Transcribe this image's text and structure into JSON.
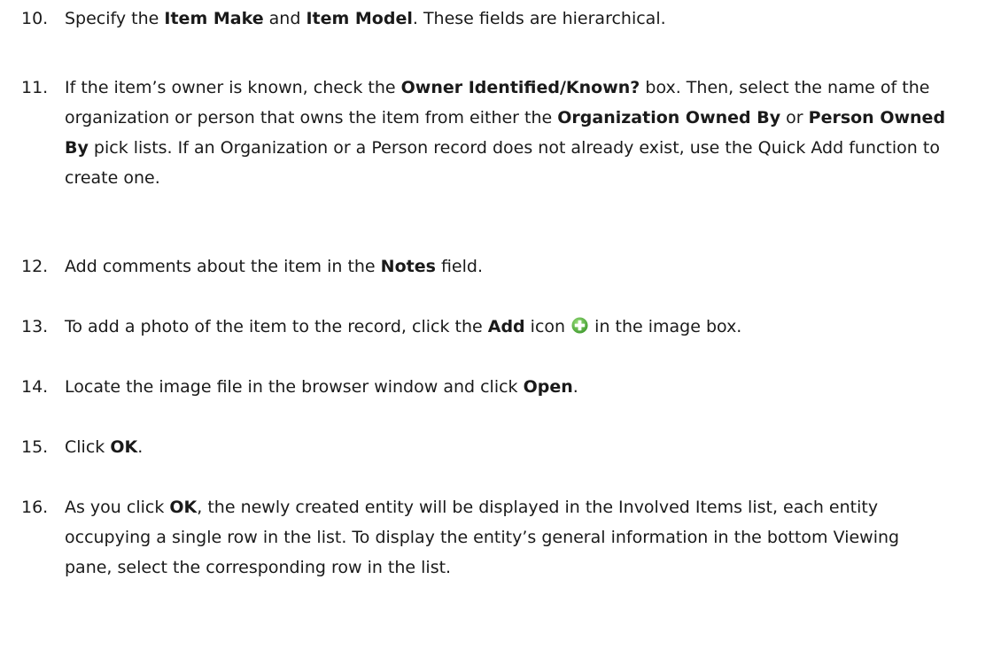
{
  "steps": [
    {
      "number": "10.",
      "t1": "Specify the ",
      "b1": "Item Make",
      "t2": " and ",
      "b2": "Item Model",
      "t3": ". These fields are hierarchical."
    },
    {
      "number": "11.",
      "t1": "If the item’s owner is known, check the ",
      "b1": "Owner Identified/Known?",
      "t2": " box. Then, select the name of the organization or person that owns the item from either the ",
      "b2": "Organization Owned By",
      "t3": " or ",
      "b3": "Person Owned By",
      "t4": " pick lists. If an Organization or a Person record does not already exist, use the Quick Add function to create one."
    },
    {
      "number": "12.",
      "t1": "Add comments about the item in the ",
      "b1": "Notes",
      "t2": " field."
    },
    {
      "number": "13.",
      "t1": "To add a photo of the item to the record, click the ",
      "b1": "Add",
      "t2": " icon ",
      "icon": "add-icon",
      "icon_color": "#5cb85c",
      "t3": " in the image box."
    },
    {
      "number": "14.",
      "t1": "Locate the image file in the browser window and click ",
      "b1": "Open",
      "t2": "."
    },
    {
      "number": "15.",
      "t1": "Click ",
      "b1": "OK",
      "t2": "."
    },
    {
      "number": "16.",
      "t1": "As you click ",
      "b1": "OK",
      "t2": ", the newly created entity will be displayed in the Involved Items list, each entity occupying a single row in the list. To display the entity’s general information in the bottom Viewing pane, select the corresponding row in the list."
    }
  ]
}
